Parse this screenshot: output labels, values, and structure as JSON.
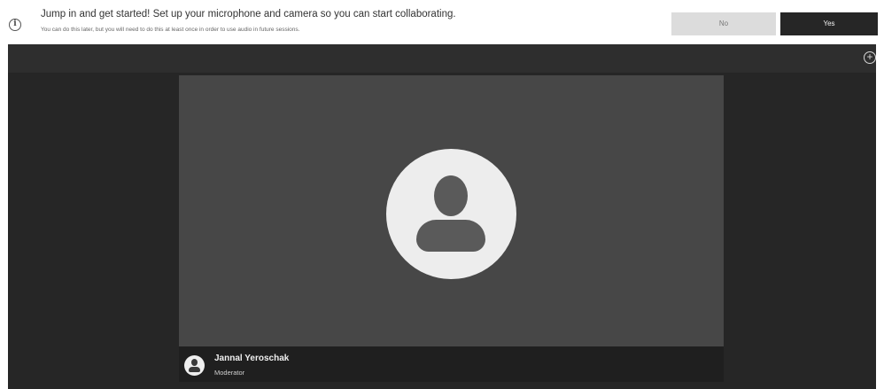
{
  "banner": {
    "title": "Jump in and get started! Set up your microphone and camera so you can start collaborating.",
    "subtitle": "You can do this later, but you will need to do this at least once in order to use audio in future sessions.",
    "info_icon": "info-icon",
    "no_label": "No",
    "yes_label": "Yes"
  },
  "stage": {
    "add_icon": "add-circle-icon"
  },
  "participant": {
    "name": "Jannal Yeroschak",
    "role": "Moderator",
    "avatar_icon": "user-avatar-icon"
  },
  "colors": {
    "yes_button": "#262626",
    "no_button": "#dcdcdc",
    "stage_bg": "#262626",
    "tile_bg": "#474747"
  }
}
